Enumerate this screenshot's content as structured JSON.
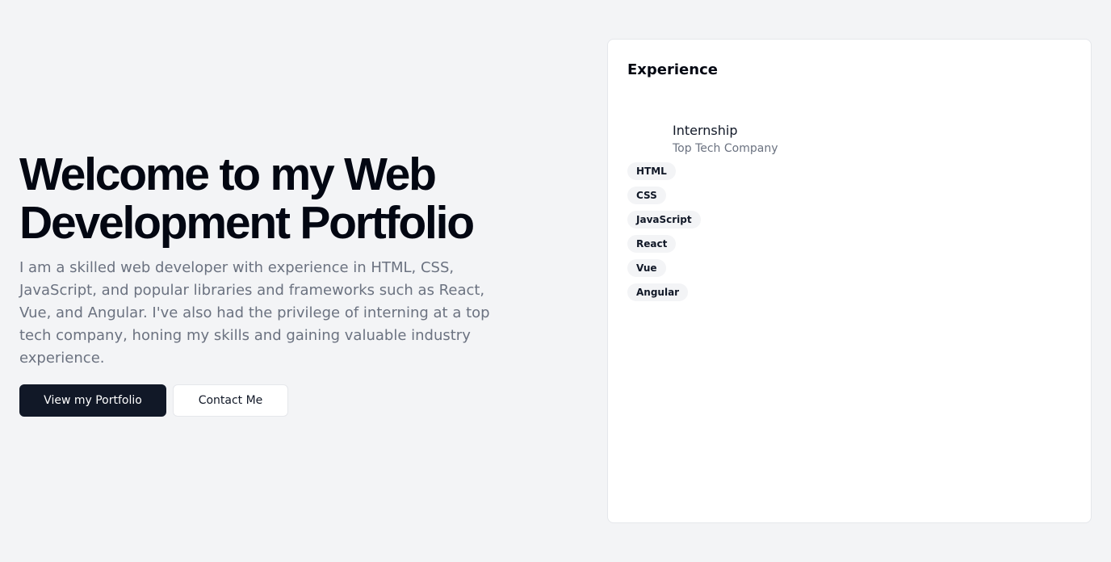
{
  "hero": {
    "title": "Welcome to my Web Development Portfolio",
    "description": "I am a skilled web developer with experience in HTML, CSS, JavaScript, and popular libraries and frameworks such as React, Vue, and Angular. I've also had the privilege of interning at a top tech company, honing my skills and gaining valuable industry experience.",
    "primary_button": "View my Portfolio",
    "secondary_button": "Contact Me"
  },
  "experience": {
    "title": "Experience",
    "role": "Internship",
    "company": "Top Tech Company",
    "skills": [
      "HTML",
      "CSS",
      "JavaScript",
      "React",
      "Vue",
      "Angular"
    ]
  },
  "colors": {
    "background": "#f3f4f6",
    "primary_button": "#111827",
    "muted_text": "#6b7280"
  }
}
